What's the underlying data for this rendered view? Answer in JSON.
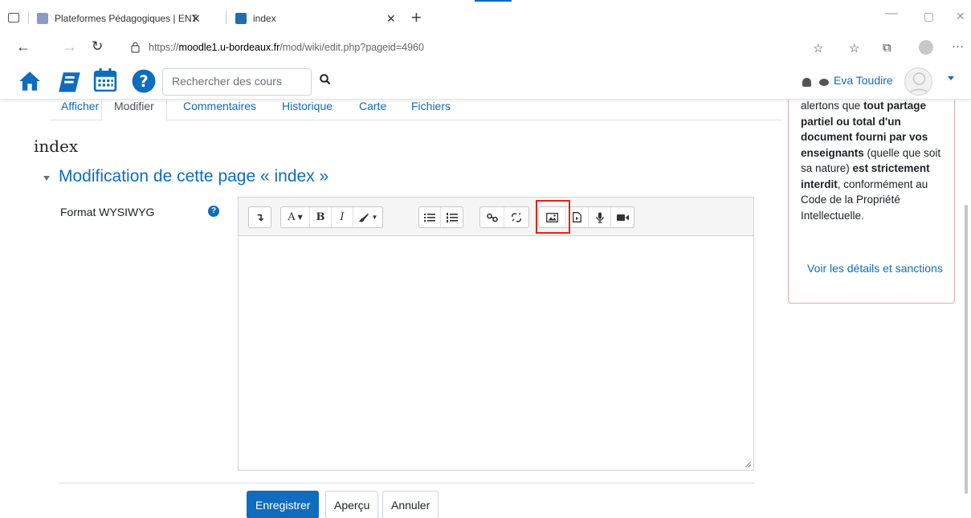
{
  "browser": {
    "tabs": [
      {
        "label": "Plateformes Pédagogiques | ENT",
        "active": false
      },
      {
        "label": "index",
        "active": true
      }
    ],
    "url_scheme": "https://",
    "url_host": "moodle1.u-bordeaux.fr",
    "url_path": "/mod/wiki/edit.php?pageid=4960"
  },
  "navbar": {
    "search_placeholder": "Rechercher des cours",
    "user_name": "Eva Toudire"
  },
  "page_tabs": [
    "Afficher",
    "Modifier",
    "Commentaires",
    "Historique",
    "Carte",
    "Fichiers"
  ],
  "active_tab": "Modifier",
  "page_title": "index",
  "section_title": "Modification de cette page « index »",
  "format_label": "Format WYSIWYG",
  "editor_toolbar": [
    [
      "show-more"
    ],
    [
      "font-size",
      "bold",
      "italic",
      "color"
    ],
    [
      "unordered-list",
      "ordered-list"
    ],
    [
      "link",
      "unlink"
    ],
    [
      "image",
      "media",
      "record-audio",
      "record-video"
    ]
  ],
  "highlighted_tool": "image",
  "buttons": {
    "save": "Enregistrer",
    "preview": "Aperçu",
    "cancel": "Annuler"
  },
  "notice": {
    "line1_pre": "alertons que ",
    "line1_bold": "tout partage partiel ou total d'un document fourni par vos enseignants",
    "line2": " (quelle que soit sa nature) ",
    "line2_bold": "est strictement interdit",
    "line3": ", conformément au Code de la Propriété Intellectuelle.",
    "link": "Voir les détails et sanctions"
  },
  "colors": {
    "brand": "#0f6cbf",
    "highlight": "#e0241b",
    "notice_border": "#e3a9a9"
  }
}
